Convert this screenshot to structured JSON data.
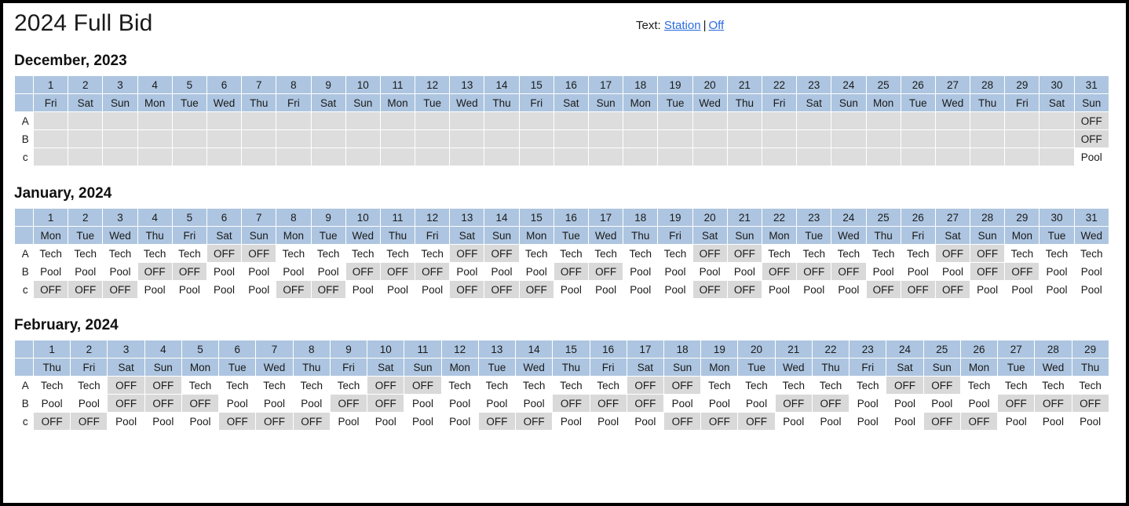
{
  "header": {
    "title": "2024 Full Bid",
    "text_label": "Text:",
    "link_station": "Station",
    "separator": "|",
    "link_off": "Off"
  },
  "row_labels": [
    "A",
    "B",
    "c"
  ],
  "cell_values": {
    "off": "OFF",
    "tech": "Tech",
    "pool": "Pool",
    "empty": ""
  },
  "months": [
    {
      "id": "december",
      "title": "December, 2023",
      "days": [
        1,
        2,
        3,
        4,
        5,
        6,
        7,
        8,
        9,
        10,
        11,
        12,
        13,
        14,
        15,
        16,
        17,
        18,
        19,
        20,
        21,
        22,
        23,
        24,
        25,
        26,
        27,
        28,
        29,
        30,
        31
      ],
      "weekdays": [
        "Fri",
        "Sat",
        "Sun",
        "Mon",
        "Tue",
        "Wed",
        "Thu",
        "Fri",
        "Sat",
        "Sun",
        "Mon",
        "Tue",
        "Wed",
        "Thu",
        "Fri",
        "Sat",
        "Sun",
        "Mon",
        "Tue",
        "Wed",
        "Thu",
        "Fri",
        "Sat",
        "Sun",
        "Mon",
        "Tue",
        "Wed",
        "Thu",
        "Fri",
        "Sat",
        "Sun"
      ],
      "rows": [
        {
          "label": "A",
          "cells": [
            "",
            "",
            "",
            "",
            "",
            "",
            "",
            "",
            "",
            "",
            "",
            "",
            "",
            "",
            "",
            "",
            "",
            "",
            "",
            "",
            "",
            "",
            "",
            "",
            "",
            "",
            "",
            "",
            "",
            "",
            "OFF"
          ]
        },
        {
          "label": "B",
          "cells": [
            "",
            "",
            "",
            "",
            "",
            "",
            "",
            "",
            "",
            "",
            "",
            "",
            "",
            "",
            "",
            "",
            "",
            "",
            "",
            "",
            "",
            "",
            "",
            "",
            "",
            "",
            "",
            "",
            "",
            "",
            "OFF"
          ]
        },
        {
          "label": "c",
          "cells": [
            "",
            "",
            "",
            "",
            "",
            "",
            "",
            "",
            "",
            "",
            "",
            "",
            "",
            "",
            "",
            "",
            "",
            "",
            "",
            "",
            "",
            "",
            "",
            "",
            "",
            "",
            "",
            "",
            "",
            "",
            "Pool"
          ]
        }
      ]
    },
    {
      "id": "january",
      "title": "January, 2024",
      "days": [
        1,
        2,
        3,
        4,
        5,
        6,
        7,
        8,
        9,
        10,
        11,
        12,
        13,
        14,
        15,
        16,
        17,
        18,
        19,
        20,
        21,
        22,
        23,
        24,
        25,
        26,
        27,
        28,
        29,
        30,
        31
      ],
      "weekdays": [
        "Mon",
        "Tue",
        "Wed",
        "Thu",
        "Fri",
        "Sat",
        "Sun",
        "Mon",
        "Tue",
        "Wed",
        "Thu",
        "Fri",
        "Sat",
        "Sun",
        "Mon",
        "Tue",
        "Wed",
        "Thu",
        "Fri",
        "Sat",
        "Sun",
        "Mon",
        "Tue",
        "Wed",
        "Thu",
        "Fri",
        "Sat",
        "Sun",
        "Mon",
        "Tue",
        "Wed"
      ],
      "rows": [
        {
          "label": "A",
          "cells": [
            "Tech",
            "Tech",
            "Tech",
            "Tech",
            "Tech",
            "OFF",
            "OFF",
            "Tech",
            "Tech",
            "Tech",
            "Tech",
            "Tech",
            "OFF",
            "OFF",
            "Tech",
            "Tech",
            "Tech",
            "Tech",
            "Tech",
            "OFF",
            "OFF",
            "Tech",
            "Tech",
            "Tech",
            "Tech",
            "Tech",
            "OFF",
            "OFF",
            "Tech",
            "Tech",
            "Tech"
          ]
        },
        {
          "label": "B",
          "cells": [
            "Pool",
            "Pool",
            "Pool",
            "OFF",
            "OFF",
            "Pool",
            "Pool",
            "Pool",
            "Pool",
            "OFF",
            "OFF",
            "OFF",
            "Pool",
            "Pool",
            "Pool",
            "OFF",
            "OFF",
            "Pool",
            "Pool",
            "Pool",
            "Pool",
            "OFF",
            "OFF",
            "OFF",
            "Pool",
            "Pool",
            "Pool",
            "OFF",
            "OFF",
            "Pool",
            "Pool"
          ]
        },
        {
          "label": "c",
          "cells": [
            "OFF",
            "OFF",
            "OFF",
            "Pool",
            "Pool",
            "Pool",
            "Pool",
            "OFF",
            "OFF",
            "Pool",
            "Pool",
            "Pool",
            "OFF",
            "OFF",
            "OFF",
            "Pool",
            "Pool",
            "Pool",
            "Pool",
            "OFF",
            "OFF",
            "Pool",
            "Pool",
            "Pool",
            "OFF",
            "OFF",
            "OFF",
            "Pool",
            "Pool",
            "Pool",
            "Pool"
          ]
        }
      ]
    },
    {
      "id": "february",
      "title": "February, 2024",
      "days": [
        1,
        2,
        3,
        4,
        5,
        6,
        7,
        8,
        9,
        10,
        11,
        12,
        13,
        14,
        15,
        16,
        17,
        18,
        19,
        20,
        21,
        22,
        23,
        24,
        25,
        26,
        27,
        28,
        29
      ],
      "weekdays": [
        "Thu",
        "Fri",
        "Sat",
        "Sun",
        "Mon",
        "Tue",
        "Wed",
        "Thu",
        "Fri",
        "Sat",
        "Sun",
        "Mon",
        "Tue",
        "Wed",
        "Thu",
        "Fri",
        "Sat",
        "Sun",
        "Mon",
        "Tue",
        "Wed",
        "Thu",
        "Fri",
        "Sat",
        "Sun",
        "Mon",
        "Tue",
        "Wed",
        "Thu"
      ],
      "rows": [
        {
          "label": "A",
          "cells": [
            "Tech",
            "Tech",
            "OFF",
            "OFF",
            "Tech",
            "Tech",
            "Tech",
            "Tech",
            "Tech",
            "OFF",
            "OFF",
            "Tech",
            "Tech",
            "Tech",
            "Tech",
            "Tech",
            "OFF",
            "OFF",
            "Tech",
            "Tech",
            "Tech",
            "Tech",
            "Tech",
            "OFF",
            "OFF",
            "Tech",
            "Tech",
            "Tech",
            "Tech"
          ]
        },
        {
          "label": "B",
          "cells": [
            "Pool",
            "Pool",
            "OFF",
            "OFF",
            "OFF",
            "Pool",
            "Pool",
            "Pool",
            "OFF",
            "OFF",
            "Pool",
            "Pool",
            "Pool",
            "Pool",
            "OFF",
            "OFF",
            "OFF",
            "Pool",
            "Pool",
            "Pool",
            "OFF",
            "OFF",
            "Pool",
            "Pool",
            "Pool",
            "Pool",
            "OFF",
            "OFF",
            "OFF"
          ]
        },
        {
          "label": "c",
          "cells": [
            "OFF",
            "OFF",
            "Pool",
            "Pool",
            "Pool",
            "OFF",
            "OFF",
            "OFF",
            "Pool",
            "Pool",
            "Pool",
            "Pool",
            "OFF",
            "OFF",
            "Pool",
            "Pool",
            "Pool",
            "OFF",
            "OFF",
            "OFF",
            "Pool",
            "Pool",
            "Pool",
            "Pool",
            "OFF",
            "OFF",
            "Pool",
            "Pool",
            "Pool"
          ]
        }
      ]
    }
  ]
}
